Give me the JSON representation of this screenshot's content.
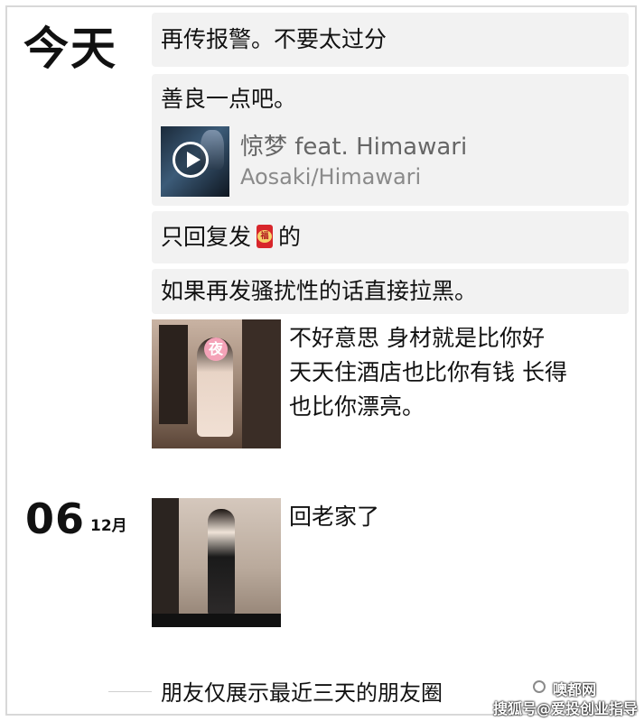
{
  "timeline": {
    "today_label": "今天",
    "posts": [
      {
        "text": "再传报警。不要太过分"
      },
      {
        "text": "善良一点吧。",
        "music": {
          "title": "惊梦 feat. Himawari",
          "artist": "Aosaki/Himawari"
        }
      },
      {
        "text_before": "只回复发",
        "sticker": "福",
        "text_after": "的"
      },
      {
        "text": "如果再发骚扰性的话直接拉黑。"
      },
      {
        "photo_badge": "夜",
        "caption_lines": [
          "不好意思 身材就是比你好",
          "天天住酒店也比你有钱 长得",
          "也比你漂亮。"
        ]
      }
    ],
    "date_group": {
      "day": "06",
      "month": "12月",
      "caption": "回老家了"
    }
  },
  "footer": {
    "text": "朋友仅展示最近三天的朋友圈"
  },
  "watermark": {
    "line1": "噢都网",
    "line2": "搜狐号@爱投创业指导"
  },
  "colors": {
    "row_bg": "#f2f2f2",
    "text": "#111111",
    "music_title": "#666666",
    "music_artist": "#8a8a8a",
    "hongbao": "#d8262b"
  }
}
